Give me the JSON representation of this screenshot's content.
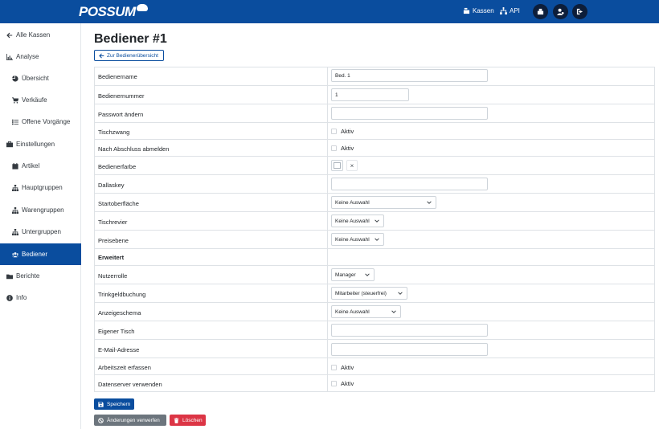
{
  "header": {
    "logo": "POSSUM",
    "kassen_label": "Kassen",
    "api_label": "API",
    "colors": {
      "bar": "#0a4d9e",
      "circle": "#0d1e3a"
    }
  },
  "sidebar": {
    "items": [
      {
        "label": "Alle Kassen",
        "icon": "arrow-left-icon"
      },
      {
        "label": "Analyse",
        "icon": "chart-icon"
      },
      {
        "label": "Übersicht",
        "icon": "pie-icon"
      },
      {
        "label": "Verkäufe",
        "icon": "cart-icon"
      },
      {
        "label": "Offene Vorgänge",
        "icon": "list-icon"
      },
      {
        "label": "Einstellungen",
        "icon": "tools-icon"
      },
      {
        "label": "Artikel",
        "icon": "calendar-icon"
      },
      {
        "label": "Hauptgruppen",
        "icon": "sitemap-icon"
      },
      {
        "label": "Warengruppen",
        "icon": "sitemap-icon"
      },
      {
        "label": "Untergruppen",
        "icon": "sitemap-icon"
      },
      {
        "label": "Bediener",
        "icon": "users-icon",
        "active": true
      },
      {
        "label": "Berichte",
        "icon": "folder-icon"
      },
      {
        "label": "Info",
        "icon": "info-icon"
      }
    ]
  },
  "page": {
    "title": "Bediener #1",
    "back_label": "Zur Bedienerübersicht"
  },
  "form": {
    "name_label": "Bedienername",
    "name_value": "Bed. 1",
    "number_label": "Bedienernummer",
    "number_value": "1",
    "password_label": "Passwort ändern",
    "password_value": "",
    "tischzwang_label": "Tischzwang",
    "tischzwang_check": "Aktiv",
    "logout_label": "Nach Abschluss abmelden",
    "logout_check": "Aktiv",
    "color_label": "Bedienerfarbe",
    "color_clear": "×",
    "dallas_label": "Dallaskey",
    "dallas_value": "",
    "start_label": "Startoberfläche",
    "start_value": "Keine Auswahl",
    "revier_label": "Tischrevier",
    "revier_value": "Keine Auswahl",
    "preis_label": "Preisebene",
    "preis_value": "Keine Auswahl",
    "erweitert_label": "Erweitert",
    "rolle_label": "Nutzerrolle",
    "rolle_value": "Manager",
    "trinkgeld_label": "Trinkgeldbuchung",
    "trinkgeld_value": "Mitarbeiter (steuerfrei)",
    "schema_label": "Anzeigeschema",
    "schema_value": "Keine Auswahl",
    "tisch_label": "Eigener Tisch",
    "tisch_value": "",
    "email_label": "E-Mail-Adresse",
    "email_value": "",
    "arbeitszeit_label": "Arbeitszeit erfassen",
    "arbeitszeit_check": "Aktiv",
    "datenserver_label": "Datenserver verwenden",
    "datenserver_check": "Aktiv"
  },
  "actions": {
    "save_label": "Speichern",
    "discard_label": "Änderungen verwerfen",
    "delete_label": "Löschen",
    "colors": {
      "save": "#0a4d9e",
      "discard": "#6c757d",
      "delete": "#dc3545"
    }
  }
}
